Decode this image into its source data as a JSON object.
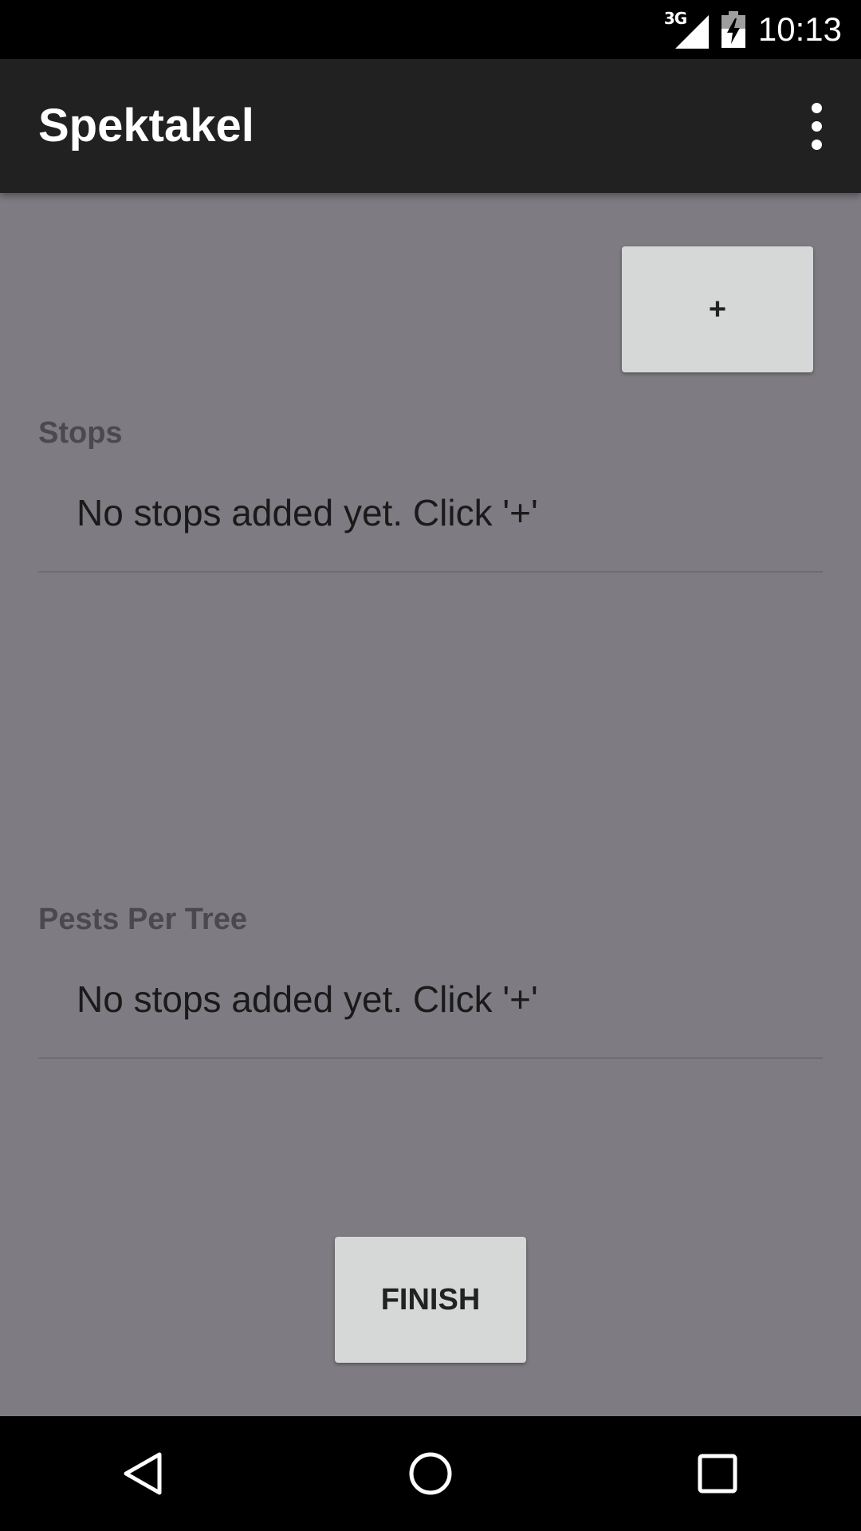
{
  "status_bar": {
    "network": "3G",
    "time": "10:13",
    "icons": [
      "signal-icon",
      "battery-charging-icon"
    ]
  },
  "app_bar": {
    "title": "Spektakel",
    "overflow_icon": "more-vert-icon"
  },
  "main": {
    "add_button_label": "+",
    "stops": {
      "label": "Stops",
      "empty_text": "No stops added yet. Click '+'"
    },
    "pests": {
      "label": "Pests Per Tree",
      "empty_text": "No stops added yet. Click '+'"
    },
    "finish_button_label": "FINISH"
  },
  "nav_bar": {
    "icons": [
      "back-icon",
      "home-icon",
      "recents-icon"
    ]
  },
  "colors": {
    "background": "#7e7c82",
    "app_bar": "#212121",
    "button": "#d6d7d7",
    "section_label": "#4a494d"
  }
}
